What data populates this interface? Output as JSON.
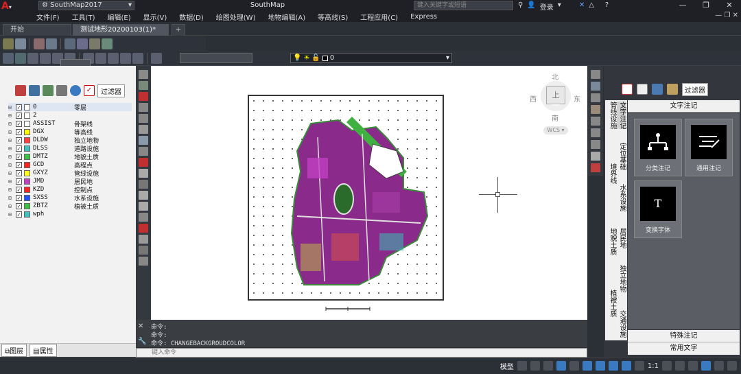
{
  "app": {
    "profile": "SouthMap2017",
    "title": "SouthMap",
    "search_placeholder": "键入关键字或短语",
    "login": "登录"
  },
  "menu": [
    "文件(F)",
    "工具(T)",
    "编辑(E)",
    "显示(V)",
    "数据(D)",
    "绘图处理(W)",
    "地物编辑(A)",
    "等高线(S)",
    "工程应用(C)",
    "Express"
  ],
  "tabs": {
    "start": "开始",
    "document": "测试地形20200103(1)*",
    "add": "+"
  },
  "layer_state": {
    "current": "0"
  },
  "left_panel": {
    "filter_label": "过滤器",
    "layers": [
      {
        "name": "0",
        "desc": "零层",
        "color": "#ffffff"
      },
      {
        "name": "2",
        "desc": "",
        "color": "#ffffff"
      },
      {
        "name": "ASSIST",
        "desc": "骨架线",
        "color": "#ffffff"
      },
      {
        "name": "DGX",
        "desc": "等高线",
        "color": "#ffff00"
      },
      {
        "name": "DLDW",
        "desc": "独立地物",
        "color": "#ff4040"
      },
      {
        "name": "DLSS",
        "desc": "道路设施",
        "color": "#40c0c0"
      },
      {
        "name": "DMTZ",
        "desc": "地貌土质",
        "color": "#40c040"
      },
      {
        "name": "GCD",
        "desc": "高程点",
        "color": "#ff2020"
      },
      {
        "name": "GXYZ",
        "desc": "管线设施",
        "color": "#ffff20"
      },
      {
        "name": "JMD",
        "desc": "居民地",
        "color": "#c040c0"
      },
      {
        "name": "KZD",
        "desc": "控制点",
        "color": "#ff2020"
      },
      {
        "name": "SXSS",
        "desc": "水系设施",
        "color": "#2050ff"
      },
      {
        "name": "ZBTZ",
        "desc": "植被土质",
        "color": "#40c040"
      },
      {
        "name": "wph",
        "desc": "",
        "color": "#40c0c0"
      }
    ],
    "tab_layers": "图层",
    "tab_props": "属性"
  },
  "compass": {
    "north": "北",
    "south": "南",
    "east": "东",
    "west": "西",
    "top": "上",
    "ucs": "WCS"
  },
  "command": {
    "lines": [
      "命令:",
      "命令:",
      "命令: CHANGEBACKGROUDCOLOR"
    ],
    "placeholder": "键入命令"
  },
  "right_panel": {
    "filter_label": "过滤器",
    "header": "文字注记",
    "vtabs": [
      "管线设施",
      "文字注记",
      "定位基础",
      "境界线",
      "水系设施",
      "地貌土质",
      "居民地",
      "独立地物",
      "植被土质",
      "交通设施"
    ],
    "tiles": [
      {
        "label": "分类注记",
        "icon": "tree-icon"
      },
      {
        "label": "通用注记",
        "icon": "edit-text-icon"
      },
      {
        "label": "变换字体",
        "icon": "T"
      }
    ],
    "footer1": "特殊注记",
    "footer2": "常用文字"
  },
  "status": {
    "model": "模型",
    "scale": "1:1"
  }
}
